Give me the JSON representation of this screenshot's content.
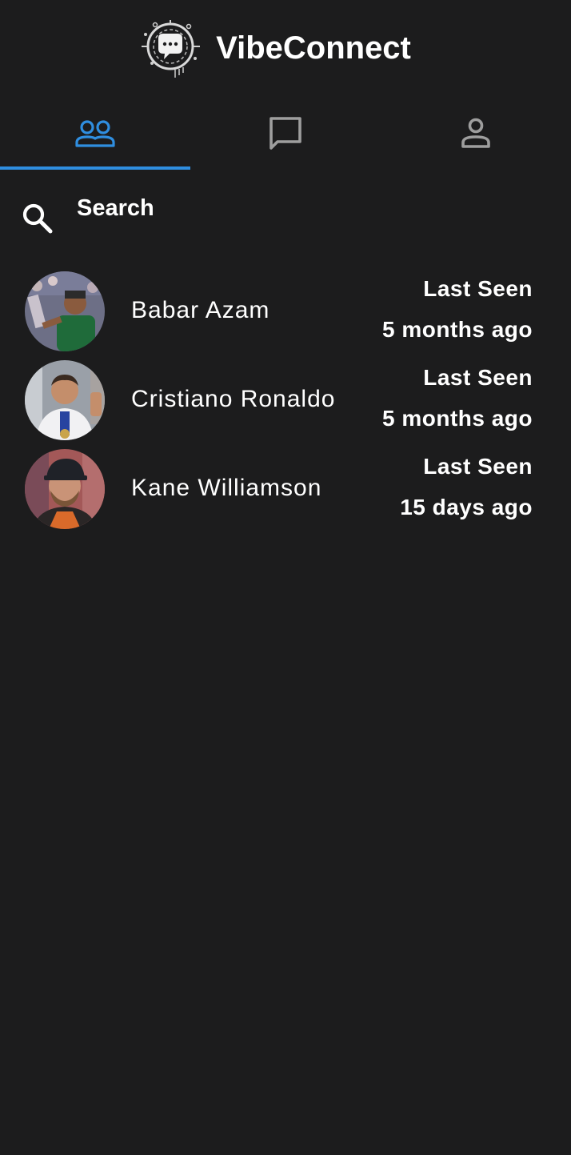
{
  "app": {
    "title": "VibeConnect",
    "logo_icon": "chat-bubble-circuit-logo"
  },
  "tabs": [
    {
      "icon": "people-icon",
      "active": true
    },
    {
      "icon": "chat-icon",
      "active": false
    },
    {
      "icon": "person-icon",
      "active": false
    }
  ],
  "search": {
    "placeholder": "Search",
    "icon": "search-icon"
  },
  "contacts": [
    {
      "name": "Babar Azam",
      "last_seen_label": "Last Seen",
      "last_seen_value": "5 months ago"
    },
    {
      "name": "Cristiano Ronaldo",
      "last_seen_label": "Last Seen",
      "last_seen_value": "5 months ago"
    },
    {
      "name": "Kane Williamson",
      "last_seen_label": "Last Seen",
      "last_seen_value": "15 days ago"
    }
  ],
  "colors": {
    "background": "#1c1c1d",
    "accent": "#2f8ee0",
    "text": "#ffffff",
    "inactive_icon": "#9e9e9e"
  }
}
